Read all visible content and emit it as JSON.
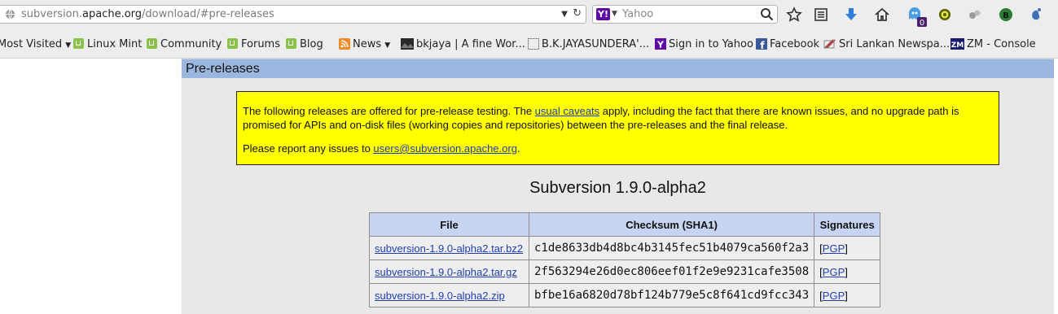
{
  "browser": {
    "url": {
      "prefix": "subversion.",
      "domain": "apache.org",
      "path": "/download/#pre-releases"
    },
    "search": {
      "engine_icon": "yahoo-icon",
      "engine_letter": "Y!",
      "placeholder": "Yahoo"
    },
    "toolbar_icons": [
      "bookmark-star-icon",
      "reading-list-icon",
      "download-arrow-icon",
      "home-icon",
      "ghostery-icon",
      "greasemonkey-icon",
      "extension-icon",
      "adblock-icon",
      "gnome-foot-icon"
    ],
    "ghostery_badge": "0",
    "bookmarks": [
      {
        "label": "Most Visited",
        "icon": "dropdown-icon"
      },
      {
        "label": "Linux Mint",
        "icon": "mint-icon"
      },
      {
        "label": "Community",
        "icon": "mint-icon"
      },
      {
        "label": "Forums",
        "icon": "mint-icon"
      },
      {
        "label": "Blog",
        "icon": "mint-icon"
      },
      {
        "label": "News",
        "icon": "rss-icon"
      },
      {
        "label": "bkjaya | A fine Wor...",
        "icon": "photo-icon"
      },
      {
        "label": "B.K.JAYASUNDERA'...",
        "icon": "page-icon"
      },
      {
        "label": "Sign in to Yahoo",
        "icon": "yahoo-icon"
      },
      {
        "label": "Facebook",
        "icon": "facebook-icon"
      },
      {
        "label": "Sri Lankan Newspa...",
        "icon": "newspaper-icon"
      },
      {
        "label": "ZM - Console",
        "icon": "zm-icon"
      }
    ]
  },
  "page": {
    "section_title": "Pre-releases",
    "notice": {
      "p1_before": "The following releases are offered for pre-release testing. The ",
      "p1_link": "usual caveats",
      "p1_after": " apply, including the fact that there are known issues, and no upgrade path is promised for APIs and on-disk files (working copies and repositories) between the pre-releases and the final release.",
      "p2_before": "Please report any issues to ",
      "p2_link": "users@subversion.apache.org",
      "p2_after": "."
    },
    "release_title": "Subversion 1.9.0-alpha2",
    "table": {
      "headers": [
        "File",
        "Checksum (SHA1)",
        "Signatures"
      ],
      "rows": [
        {
          "file": "subversion-1.9.0-alpha2.tar.bz2",
          "checksum": "c1de8633db4d8bc4b3145fec51b4079ca560f2a3",
          "sig_open": "[",
          "sig": "PGP",
          "sig_close": "]"
        },
        {
          "file": "subversion-1.9.0-alpha2.tar.gz",
          "checksum": "2f563294e26d0ec806eef01f2e9e9231cafe3508",
          "sig_open": "[",
          "sig": "PGP",
          "sig_close": "]"
        },
        {
          "file": "subversion-1.9.0-alpha2.zip",
          "checksum": "bfbe16a6820d78bf124b779e5c8f641cd9fcc343",
          "sig_open": "[",
          "sig": "PGP",
          "sig_close": "]"
        }
      ]
    }
  }
}
